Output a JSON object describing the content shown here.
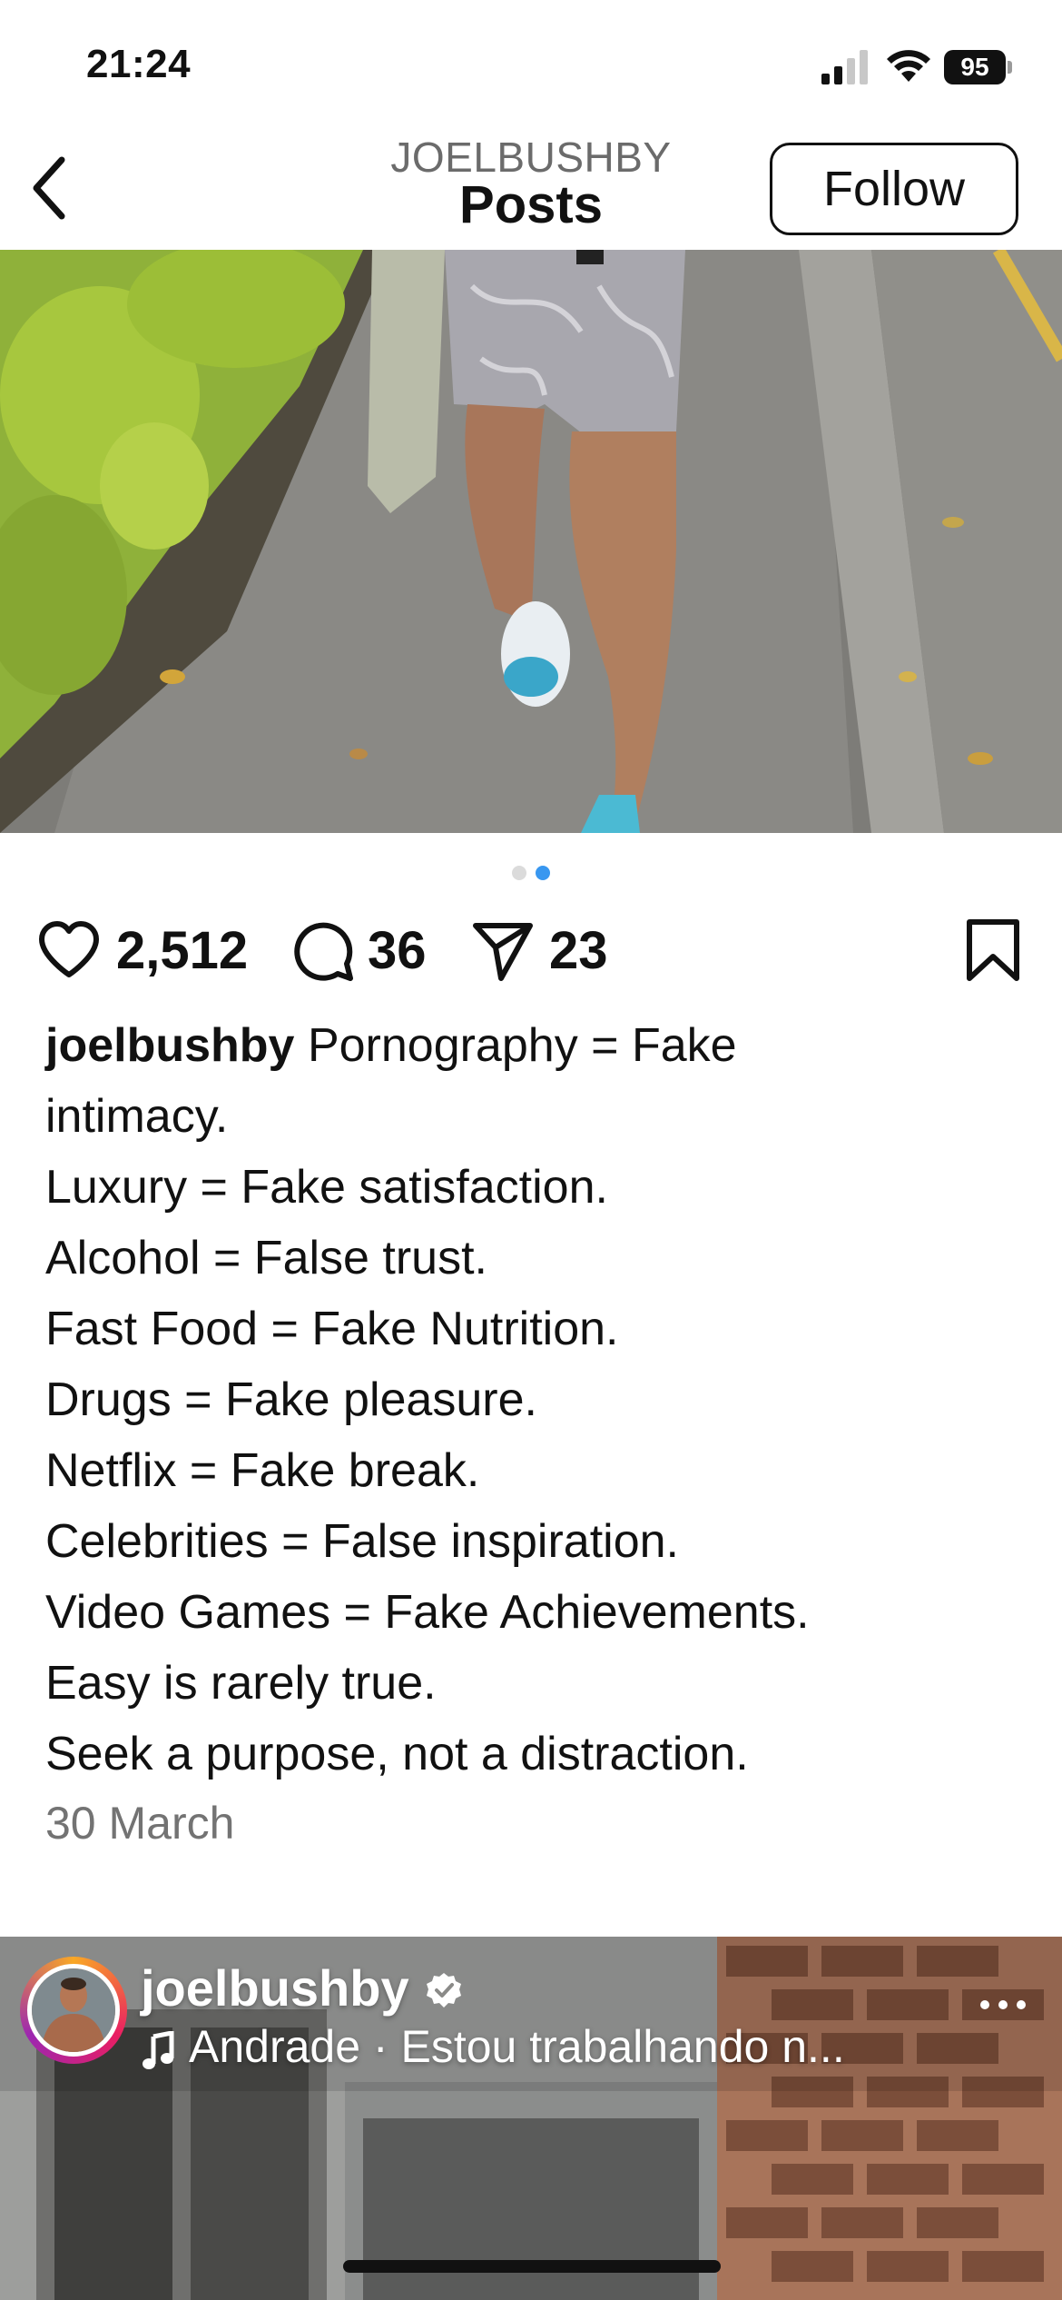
{
  "status_bar": {
    "time": "21:24",
    "battery": "95",
    "icons": [
      "signal-icon",
      "wifi-icon",
      "battery-icon"
    ]
  },
  "header": {
    "username": "JOELBUSHBY",
    "title": "Posts",
    "follow_label": "Follow",
    "back_icon": "chevron-left-icon"
  },
  "carousel": {
    "total": 2,
    "active_index": 1,
    "active_color": "#3897f0",
    "inactive_color": "#dbdbdb"
  },
  "actions": {
    "likes": "2,512",
    "comments": "36",
    "shares": "23",
    "icons": [
      "heart-icon",
      "comment-icon",
      "send-icon",
      "bookmark-icon"
    ]
  },
  "caption": {
    "username": "joelbushby",
    "first_line": "Pornography = Fake",
    "lines": [
      "intimacy.",
      "Luxury = Fake satisfaction.",
      "Alcohol = False trust.",
      "Fast Food = Fake Nutrition.",
      "Drugs = Fake pleasure.",
      "Netflix = Fake break.",
      "Celebrities = False inspiration.",
      "Video Games = Fake Achievements.",
      "Easy is rarely true.",
      "Seek a purpose, not a distraction."
    ]
  },
  "post_date": "30 March",
  "next_post": {
    "username": "joelbushby",
    "audio": "Andrade · Estou trabalhando n...",
    "icons": [
      "verified-icon",
      "music-note-icon",
      "more-icon"
    ]
  }
}
